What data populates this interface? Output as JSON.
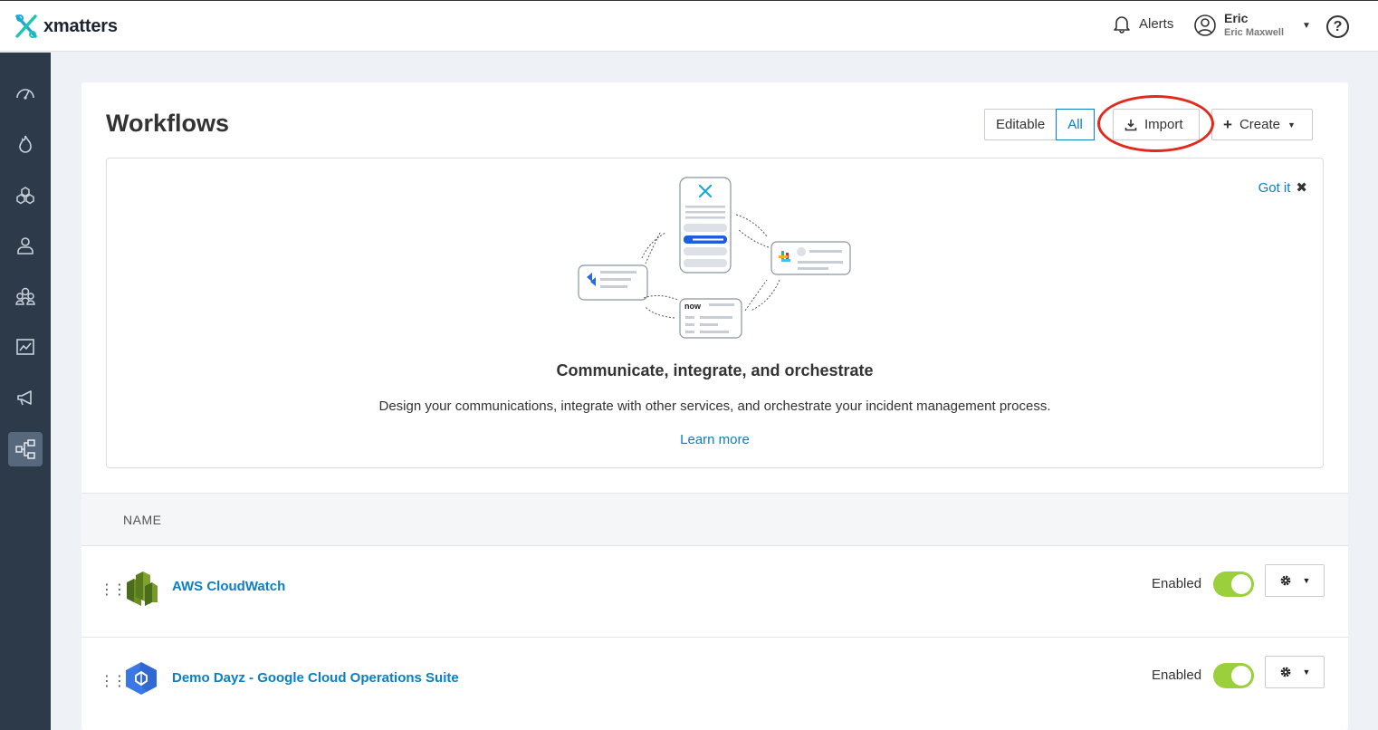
{
  "brand": {
    "name": "xmatters"
  },
  "header": {
    "alerts_label": "Alerts",
    "user": {
      "first_name": "Eric",
      "full_name": "Eric Maxwell"
    },
    "help_label": "?"
  },
  "sidebar": {
    "items": [
      {
        "icon": "dashboard-icon",
        "active": false
      },
      {
        "icon": "incidents-icon",
        "active": false
      },
      {
        "icon": "groups-icon",
        "active": false
      },
      {
        "icon": "user-icon",
        "active": false
      },
      {
        "icon": "users-icon",
        "active": false
      },
      {
        "icon": "reports-icon",
        "active": false
      },
      {
        "icon": "messaging-icon",
        "active": false
      },
      {
        "icon": "workflows-icon",
        "active": true
      }
    ]
  },
  "page": {
    "title": "Workflows",
    "filter": {
      "options": [
        "Editable",
        "All"
      ],
      "selected": "All"
    },
    "import_label": "Import",
    "create_label": "Create"
  },
  "banner": {
    "dismiss_label": "Got it",
    "title": "Communicate, integrate, and orchestrate",
    "description": "Design your communications, integrate with other services, and orchestrate your incident management process.",
    "link_label": "Learn more",
    "illustration_text": "now"
  },
  "table": {
    "columns": [
      "NAME"
    ],
    "rows": [
      {
        "name": "AWS CloudWatch",
        "icon": "aws-cloudwatch-icon",
        "status": "Enabled",
        "enabled": true
      },
      {
        "name": "Demo Dayz - Google Cloud Operations Suite",
        "icon": "google-cloud-icon",
        "status": "Enabled",
        "enabled": true
      }
    ]
  },
  "colors": {
    "accent": "#0a7fc2",
    "sidebar": "#2d3a4a",
    "toggle_on": "#9ccf3c",
    "highlight": "#e02a1e"
  }
}
